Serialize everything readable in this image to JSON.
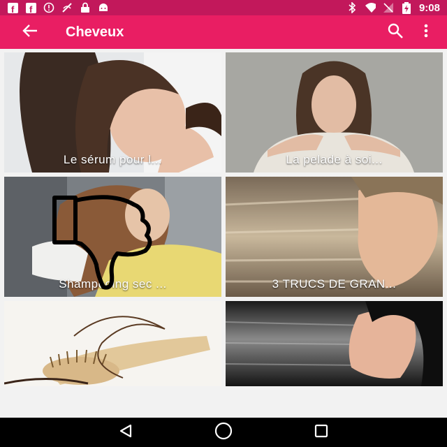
{
  "status_bar": {
    "time": "9:08",
    "icons_left": [
      "facebook-icon",
      "facebook-icon",
      "sync-icon",
      "no-signal-icon",
      "lock-icon",
      "android-icon"
    ],
    "icons_right": [
      "bluetooth-icon",
      "wifi-icon",
      "signal-off-icon",
      "battery-charging-icon"
    ]
  },
  "app_bar": {
    "title": "Cheveux",
    "back_icon": "arrow-back-icon",
    "search_icon": "search-icon",
    "menu_icon": "more-vert-icon"
  },
  "articles": [
    {
      "caption": "Le sérum pour l..."
    },
    {
      "caption": "La pelade à soi..."
    },
    {
      "caption": "Shampooing sec ..."
    },
    {
      "caption": "3 TRUCS DE GRAN..."
    },
    {
      "caption": ""
    },
    {
      "caption": ""
    }
  ],
  "colors": {
    "status_bar": "#c2185b",
    "app_bar": "#e91e63",
    "nav_bar": "#000000",
    "background": "#f2f2f2"
  },
  "nav_bar": {
    "back": "back-triangle-icon",
    "home": "home-circle-icon",
    "recents": "recents-square-icon"
  }
}
